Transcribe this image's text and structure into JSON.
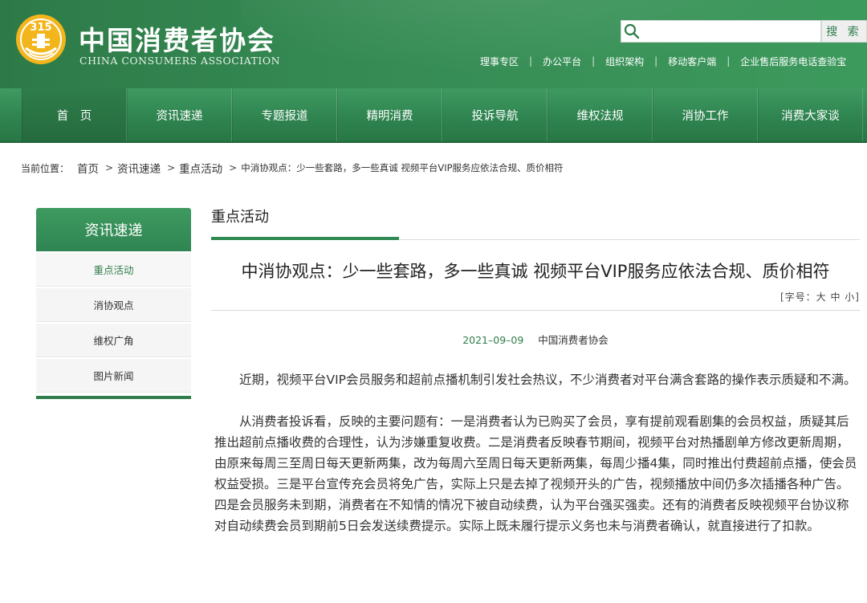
{
  "header": {
    "site_title": "中国消费者协会",
    "site_subtitle": "CHINA CONSUMERS ASSOCIATION",
    "logo_text": "315",
    "search": {
      "placeholder": "",
      "button_label": "搜 索"
    },
    "top_links": [
      "理事专区",
      "办公平台",
      "组织架构",
      "移动客户端",
      "企业售后服务电话查验宝"
    ],
    "top_link_sep": "|"
  },
  "nav": {
    "items": [
      "首　页",
      "资讯速递",
      "专题报道",
      "精明消费",
      "投诉导航",
      "维权法规",
      "消协工作",
      "消费大家谈"
    ]
  },
  "breadcrumb": {
    "prefix": "当前位置：",
    "items": [
      "首页",
      "资讯速递",
      "重点活动"
    ],
    "current": "中消协观点：少一些套路，多一些真诚 视频平台VIP服务应依法合规、质价相符",
    "arrow": ">"
  },
  "sidebar": {
    "title": "资讯速递",
    "items": [
      "重点活动",
      "消协观点",
      "维权广角",
      "图片新闻"
    ]
  },
  "main": {
    "section_title": "重点活动",
    "article": {
      "title": "中消协观点：少一些套路，多一些真诚 视频平台VIP服务应依法合规、质价相符",
      "font_size_label": "[字号：大 中 小]",
      "date": "2021–09–09",
      "source": "中国消费者协会",
      "paragraphs": [
        "近期，视频平台VIP会员服务和超前点播机制引发社会热议，不少消费者对平台满含套路的操作表示质疑和不满。",
        "从消费者投诉看，反映的主要问题有：一是消费者认为已购买了会员，享有提前观看剧集的会员权益，质疑其后推出超前点播收费的合理性，认为涉嫌重复收费。二是消费者反映春节期间，视频平台对热播剧单方修改更新周期，由原来每周三至周日每天更新两集，改为每周六至周日每天更新两集，每周少播4集，同时推出付费超前点播，使会员权益受损。三是平台宣传充会员将免广告，实际上只是去掉了视频开头的广告，视频播放中间仍多次插播各种广告。四是会员服务未到期，消费者在不知情的情况下被自动续费，认为平台强买强卖。还有的消费者反映视频平台协议称对自动续费会员到期前5日会发送续费提示。实际上既未履行提示义务也未与消费者确认，就直接进行了扣款。"
      ]
    }
  },
  "colors": {
    "brand_green": "#2e7d4a",
    "header_green": "#358a53"
  }
}
